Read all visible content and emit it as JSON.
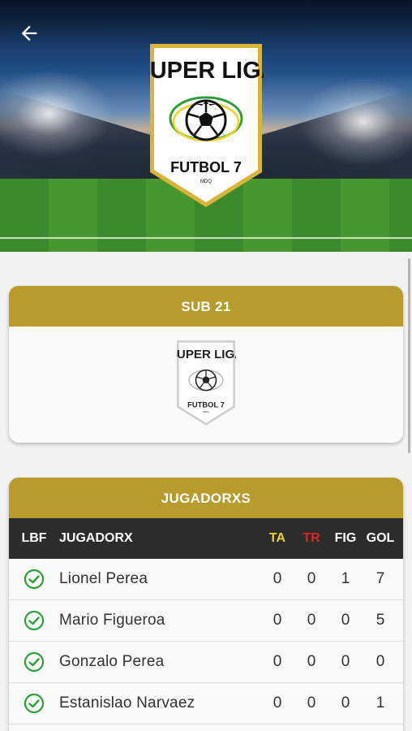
{
  "header": {
    "back_icon": "arrow-left-icon",
    "crest": {
      "line1": "SUPER LIGA",
      "line2": "FUTBOL 7",
      "line3": "MDQ"
    }
  },
  "team_card": {
    "title": "SUB 21",
    "logo": {
      "line1": "SUPER LIGA",
      "line2": "FUTBOL 7",
      "line3": "MDQ"
    }
  },
  "players_card": {
    "title": "JUGADORXS",
    "columns": {
      "lbf": "LBF",
      "player": "JUGADORX",
      "ta": "TA",
      "tr": "TR",
      "fig": "FIG",
      "gol": "GOL"
    },
    "rows": [
      {
        "name": "Lionel Perea",
        "ta": "0",
        "tr": "0",
        "fig": "1",
        "gol": "7"
      },
      {
        "name": "Mario Figueroa",
        "ta": "0",
        "tr": "0",
        "fig": "0",
        "gol": "5"
      },
      {
        "name": "Gonzalo Perea",
        "ta": "0",
        "tr": "0",
        "fig": "0",
        "gol": "0"
      },
      {
        "name": "Estanislao Narvaez",
        "ta": "0",
        "tr": "0",
        "fig": "0",
        "gol": "1"
      }
    ]
  },
  "colors": {
    "accent_gold": "#b79c2d",
    "table_header": "#2c2c2c",
    "check_green": "#2e9e3a",
    "ta_yellow": "#f2d31b",
    "tr_red": "#e02424"
  }
}
